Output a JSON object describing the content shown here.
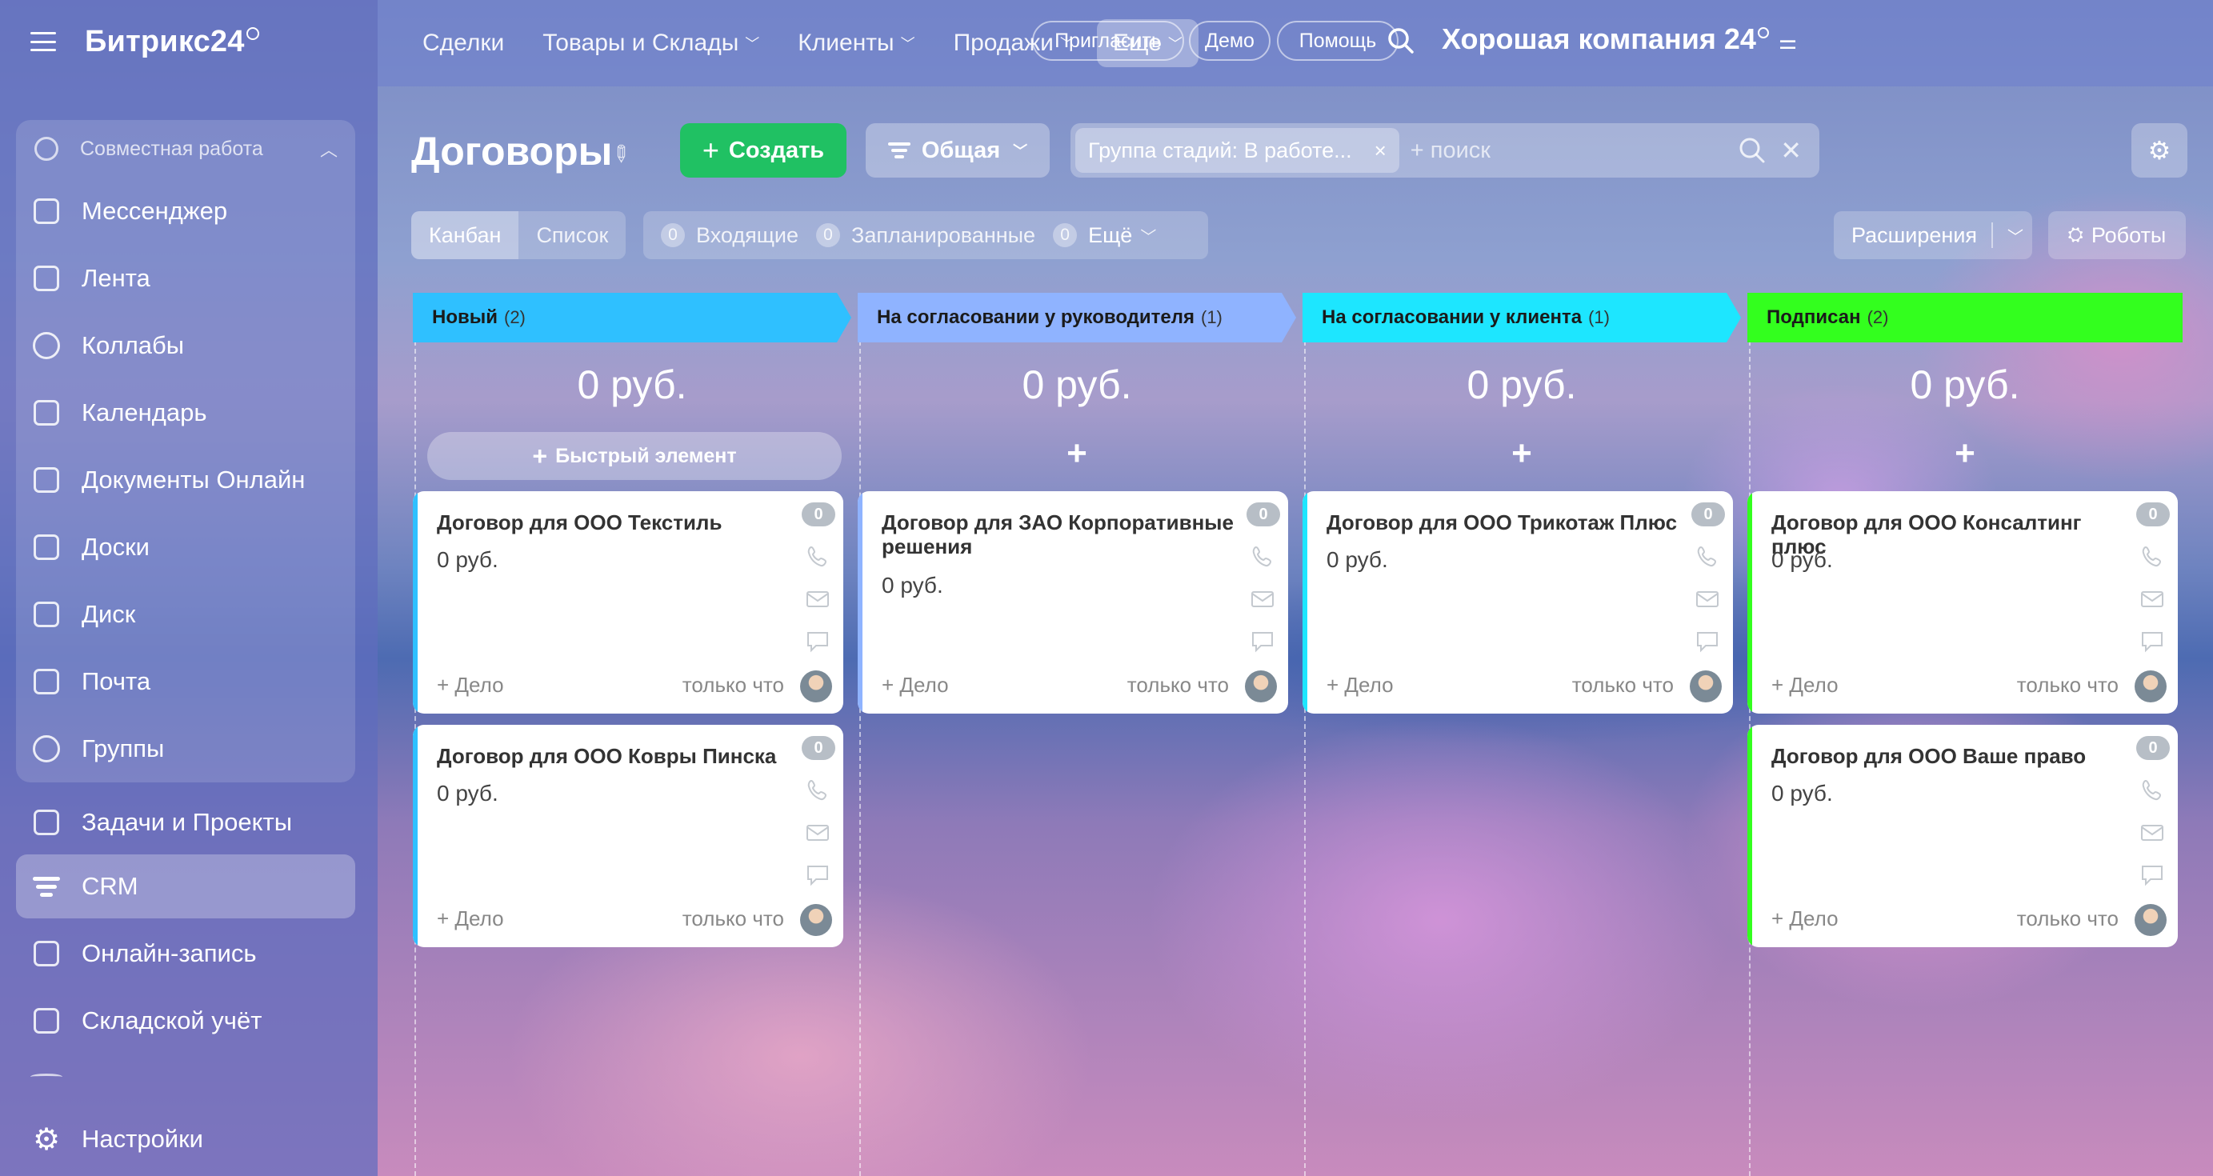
{
  "app": {
    "logo": "Битрикс24"
  },
  "sidebar": {
    "group_title": "Совместная работа",
    "group_items": [
      {
        "label": "Мессенджер",
        "icon": "messenger-icon"
      },
      {
        "label": "Лента",
        "icon": "feed-icon"
      },
      {
        "label": "Коллабы",
        "icon": "collabs-icon"
      },
      {
        "label": "Календарь",
        "icon": "calendar-icon"
      },
      {
        "label": "Документы Онлайн",
        "icon": "documents-icon"
      },
      {
        "label": "Доски",
        "icon": "boards-icon"
      },
      {
        "label": "Диск",
        "icon": "disk-icon"
      },
      {
        "label": "Почта",
        "icon": "mail-icon"
      },
      {
        "label": "Группы",
        "icon": "groups-icon"
      }
    ],
    "items": [
      {
        "label": "Задачи и Проекты",
        "icon": "tasks-icon"
      },
      {
        "label": "CRM",
        "icon": "crm-icon",
        "active": true
      },
      {
        "label": "Онлайн-запись",
        "icon": "booking-icon"
      },
      {
        "label": "Складской учёт",
        "icon": "warehouse-icon"
      }
    ],
    "settings": "Настройки"
  },
  "topnav": {
    "items": [
      "Сделки",
      "Товары и Склады",
      "Клиенты",
      "Продажи",
      "Еще"
    ],
    "company": "Хорошая компания 24",
    "invite": "Пригласить",
    "demo": "Демо",
    "help": "Помощь"
  },
  "toolbar": {
    "title": "Договоры",
    "create": "Создать",
    "general": "Общая",
    "filter_chip": "Группа стадий: В работе...",
    "search_placeholder": "+ поиск"
  },
  "subbar": {
    "kanban": "Канбан",
    "list": "Список",
    "incoming_count": "0",
    "incoming": "Входящие",
    "planned_count": "0",
    "planned": "Запланированные",
    "more_count": "0",
    "more": "Ещё",
    "extensions": "Расширения",
    "robots": "Роботы"
  },
  "columns": [
    {
      "title": "Новый",
      "count": "(2)",
      "color": "#2fc0ff",
      "sum": "0 руб.",
      "quick": "Быстрый элемент",
      "cards": [
        {
          "title": "Договор для ООО Текстиль",
          "sum": "0 руб.",
          "badge": "0",
          "delo": "+ Дело",
          "time": "только что"
        },
        {
          "title": "Договор для ООО Ковры Пинска",
          "sum": "0 руб.",
          "badge": "0",
          "delo": "+ Дело",
          "time": "только что"
        }
      ]
    },
    {
      "title": "На согласовании у руководителя",
      "count": "(1)",
      "color": "#8fb3ff",
      "sum": "0 руб.",
      "cards": [
        {
          "title": "Договор для ЗАО Корпоративные решения",
          "sum": "0 руб.",
          "badge": "0",
          "delo": "+ Дело",
          "time": "только что"
        }
      ]
    },
    {
      "title": "На согласовании у клиента",
      "count": "(1)",
      "color": "#1de6ff",
      "sum": "0 руб.",
      "cards": [
        {
          "title": "Договор для ООО Трикотаж Плюс",
          "sum": "0 руб.",
          "badge": "0",
          "delo": "+ Дело",
          "time": "только что"
        }
      ]
    },
    {
      "title": "Подписан",
      "count": "(2)",
      "color": "#33ff1e",
      "sum": "0 руб.",
      "cards": [
        {
          "title": "Договор для ООО Консалтинг плюс",
          "sum": "0 руб.",
          "badge": "0",
          "delo": "+ Дело",
          "time": "только что"
        },
        {
          "title": "Договор для ООО Ваше право",
          "sum": "0 руб.",
          "badge": "0",
          "delo": "+ Дело",
          "time": "только что"
        }
      ]
    }
  ]
}
